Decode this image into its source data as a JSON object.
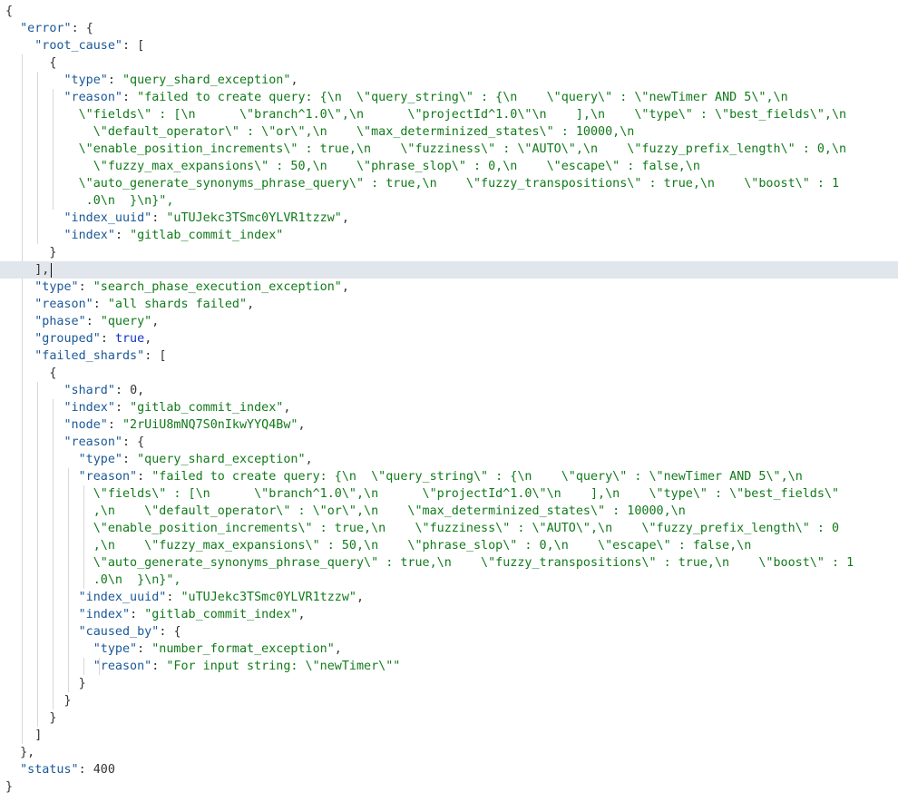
{
  "json_viewer": {
    "lines": [
      {
        "text": "{"
      },
      {
        "text": "  \"error\": {"
      },
      {
        "text": "    \"root_cause\": ["
      },
      {
        "text": "      {"
      },
      {
        "text": "        \"type\": \"query_shard_exception\","
      },
      {
        "text": "        \"reason\": \"failed to create query: {\\n  \\\"query_string\\\" : {\\n    \\\"query\\\" : \\\"newTimer AND 5\\\",\\n"
      },
      {
        "text": "          \\\"fields\\\" : [\\n      \\\"branch^1.0\\\",\\n      \\\"projectId^1.0\\\"\\n    ],\\n    \\\"type\\\" : \\\"best_fields\\\",\\n"
      },
      {
        "text": "            \\\"default_operator\\\" : \\\"or\\\",\\n    \\\"max_determinized_states\\\" : 10000,\\n"
      },
      {
        "text": "          \\\"enable_position_increments\\\" : true,\\n    \\\"fuzziness\\\" : \\\"AUTO\\\",\\n    \\\"fuzzy_prefix_length\\\" : 0,\\n"
      },
      {
        "text": "            \\\"fuzzy_max_expansions\\\" : 50,\\n    \\\"phrase_slop\\\" : 0,\\n    \\\"escape\\\" : false,\\n"
      },
      {
        "text": "          \\\"auto_generate_synonyms_phrase_query\\\" : true,\\n    \\\"fuzzy_transpositions\\\" : true,\\n    \\\"boost\\\" : 1"
      },
      {
        "text": "           .0\\n  }\\n}\","
      },
      {
        "text": "        \"index_uuid\": \"uTUJekc3TSmc0YLVR1tzzw\","
      },
      {
        "text": "        \"index\": \"gitlab_commit_index\""
      },
      {
        "text": "      }"
      },
      {
        "text": "    ],"
      },
      {
        "text": "    \"type\": \"search_phase_execution_exception\","
      },
      {
        "text": "    \"reason\": \"all shards failed\","
      },
      {
        "text": "    \"phase\": \"query\","
      },
      {
        "text": "    \"grouped\": true,"
      },
      {
        "text": "    \"failed_shards\": ["
      },
      {
        "text": "      {"
      },
      {
        "text": "        \"shard\": 0,"
      },
      {
        "text": "        \"index\": \"gitlab_commit_index\","
      },
      {
        "text": "        \"node\": \"2rUiU8mNQ7S0nIkwYYQ4Bw\","
      },
      {
        "text": "        \"reason\": {"
      },
      {
        "text": "          \"type\": \"query_shard_exception\","
      },
      {
        "text": "          \"reason\": \"failed to create query: {\\n  \\\"query_string\\\" : {\\n    \\\"query\\\" : \\\"newTimer AND 5\\\",\\n"
      },
      {
        "text": "            \\\"fields\\\" : [\\n      \\\"branch^1.0\\\",\\n      \\\"projectId^1.0\\\"\\n    ],\\n    \\\"type\\\" : \\\"best_fields\\\""
      },
      {
        "text": "            ,\\n    \\\"default_operator\\\" : \\\"or\\\",\\n    \\\"max_determinized_states\\\" : 10000,\\n"
      },
      {
        "text": "            \\\"enable_position_increments\\\" : true,\\n    \\\"fuzziness\\\" : \\\"AUTO\\\",\\n    \\\"fuzzy_prefix_length\\\" : 0"
      },
      {
        "text": "            ,\\n    \\\"fuzzy_max_expansions\\\" : 50,\\n    \\\"phrase_slop\\\" : 0,\\n    \\\"escape\\\" : false,\\n"
      },
      {
        "text": "            \\\"auto_generate_synonyms_phrase_query\\\" : true,\\n    \\\"fuzzy_transpositions\\\" : true,\\n    \\\"boost\\\" : 1"
      },
      {
        "text": "            .0\\n  }\\n}\","
      },
      {
        "text": "          \"index_uuid\": \"uTUJekc3TSmc0YLVR1tzzw\","
      },
      {
        "text": "          \"index\": \"gitlab_commit_index\","
      },
      {
        "text": "          \"caused_by\": {"
      },
      {
        "text": "            \"type\": \"number_format_exception\","
      },
      {
        "text": "            \"reason\": \"For input string: \\\"newTimer\\\"\""
      },
      {
        "text": "          }"
      },
      {
        "text": "        }"
      },
      {
        "text": "      }"
      },
      {
        "text": "    ]"
      },
      {
        "text": "  },"
      },
      {
        "text": "  \"status\": 400"
      },
      {
        "text": "}"
      }
    ]
  },
  "colors": {
    "key": "#1a5898",
    "string": "#117a1a",
    "number": "#333333",
    "boolean": "#1230c8",
    "punctuation": "#333333",
    "active_line": "#e1e5ec",
    "indent_guide": "#d8d8d8"
  }
}
